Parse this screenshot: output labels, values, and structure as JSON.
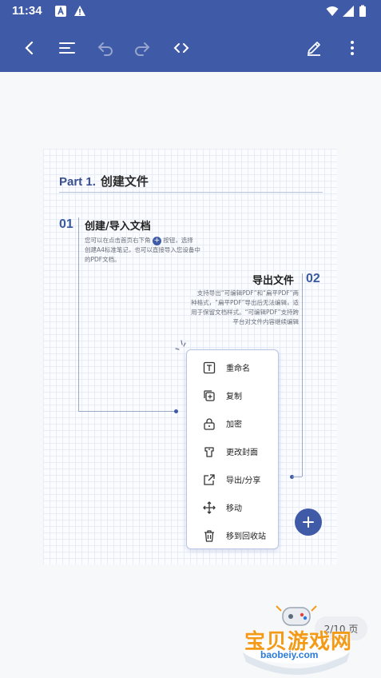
{
  "status_bar": {
    "time": "11:34"
  },
  "toolbar": {
    "back": "back-icon",
    "outline": "outline-icon",
    "undo": "undo-icon",
    "redo": "redo-icon",
    "code": "code-icon",
    "edit": "edit-pen-icon",
    "more": "more-vert-icon"
  },
  "document": {
    "part_label": "Part 1.",
    "part_title": "创建文件",
    "section1": {
      "number": "01",
      "heading": "创建/导入文档",
      "line1a": "您可以在点击首页右下角",
      "line1b": "按钮，选择",
      "line2": "创建A4标准笔记，也可以直接导入您设备中",
      "line3": "的PDF文档。"
    },
    "section2": {
      "number": "02",
      "heading": "导出文件",
      "line1": "支持导出“可编辑PDF”和“扁平PDF”两",
      "line2": "种格式，“扁平PDF”导出后无法编辑，适",
      "line3": "用于保留文档样式。“可编辑PDF”支持跨",
      "line4": "平台对文件内容继续编辑"
    }
  },
  "context_menu": {
    "items": [
      {
        "label": "重命名",
        "icon": "rename-icon"
      },
      {
        "label": "复制",
        "icon": "copy-icon"
      },
      {
        "label": "加密",
        "icon": "lock-icon"
      },
      {
        "label": "更改封面",
        "icon": "cover-icon"
      },
      {
        "label": "导出/分享",
        "icon": "share-icon"
      },
      {
        "label": "移动",
        "icon": "move-icon"
      },
      {
        "label": "移到回收站",
        "icon": "trash-icon"
      }
    ]
  },
  "page_indicator": "2/10 页",
  "watermark": {
    "text": "宝贝游戏网",
    "url": "baobeiy.com"
  },
  "colors": {
    "primary": "#3f5aa6",
    "page_bg": "#fbfcff",
    "accent": "#f39a17"
  }
}
